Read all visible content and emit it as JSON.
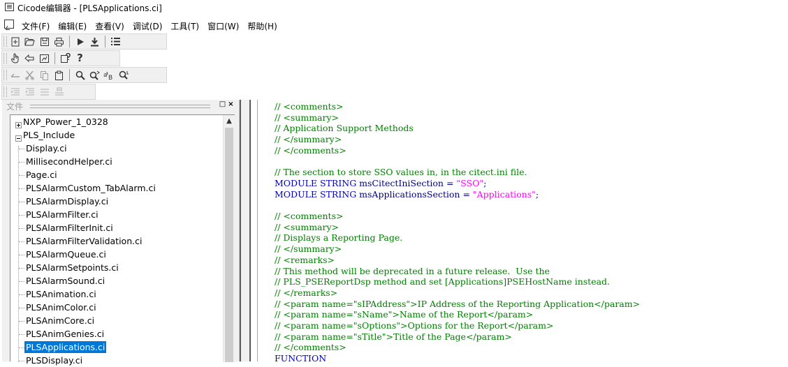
{
  "window": {
    "title": "Cicode编辑器 - [PLSApplications.ci]"
  },
  "menu": {
    "items": [
      "文件(F)",
      "编辑(E)",
      "查看(V)",
      "调试(D)",
      "工具(T)",
      "窗口(W)",
      "帮助(H)"
    ]
  },
  "toolbars": {
    "row1": [
      "new-file-icon",
      "open-folder-icon",
      "save-icon",
      "print-icon",
      "run-icon",
      "compile-icon",
      "list-icon"
    ],
    "row2": [
      "hand-icon",
      "undo-arrow-icon",
      "properties-icon",
      "help-context-icon",
      "help-icon"
    ],
    "row3": [
      "undo-icon",
      "cut-icon",
      "copy-icon",
      "paste-icon",
      "find-icon",
      "find-next-icon",
      "replace-icon",
      "find-in-files-icon"
    ],
    "row4": [
      "indent-icon",
      "outdent-icon",
      "align-icon",
      "bookmark-icon"
    ]
  },
  "files_panel": {
    "label": "文件",
    "minimize_btn": "□",
    "close_btn": "×",
    "tree": [
      {
        "label": "NXP_Power_1_0328",
        "level": 0,
        "expanded": false
      },
      {
        "label": "PLS_Include",
        "level": 0,
        "expanded": true
      },
      {
        "label": "Display.ci",
        "level": 1
      },
      {
        "label": "MillisecondHelper.ci",
        "level": 1
      },
      {
        "label": "Page.ci",
        "level": 1
      },
      {
        "label": "PLSAlarmCustom_TabAlarm.ci",
        "level": 1
      },
      {
        "label": "PLSAlarmDisplay.ci",
        "level": 1
      },
      {
        "label": "PLSAlarmFilter.ci",
        "level": 1
      },
      {
        "label": "PLSAlarmFilterInit.ci",
        "level": 1
      },
      {
        "label": "PLSAlarmFilterValidation.ci",
        "level": 1
      },
      {
        "label": "PLSAlarmQueue.ci",
        "level": 1
      },
      {
        "label": "PLSAlarmSetpoints.ci",
        "level": 1
      },
      {
        "label": "PLSAlarmSound.ci",
        "level": 1
      },
      {
        "label": "PLSAnimation.ci",
        "level": 1
      },
      {
        "label": "PLSAnimColor.ci",
        "level": 1
      },
      {
        "label": "PLSAnimCore.ci",
        "level": 1
      },
      {
        "label": "PLSAnimGenies.ci",
        "level": 1
      },
      {
        "label": "PLSApplications.ci",
        "level": 1,
        "selected": true
      },
      {
        "label": "PLSDisplay.ci",
        "level": 1
      }
    ]
  },
  "colors": {
    "comment": "#008000",
    "keyword": "#0000c0",
    "string": "#ff00ff",
    "selection": "#0078d7"
  },
  "editor": {
    "lines": [
      [
        {
          "t": "// <comments>",
          "c": "comment"
        }
      ],
      [
        {
          "t": "// <summary>",
          "c": "comment"
        }
      ],
      [
        {
          "t": "// Application Support Methods",
          "c": "comment"
        }
      ],
      [
        {
          "t": "// </summary>",
          "c": "comment"
        }
      ],
      [
        {
          "t": "// </comments>",
          "c": "comment"
        }
      ],
      [],
      [
        {
          "t": "// The section to store SSO values in, in the citect.ini file.",
          "c": "comment"
        }
      ],
      [
        {
          "t": "MODULE STRING ",
          "c": "kw"
        },
        {
          "t": "msCitectIniSection = ",
          "c": "plain"
        },
        {
          "t": "\"SSO\"",
          "c": "str"
        },
        {
          "t": ";",
          "c": "plain"
        }
      ],
      [
        {
          "t": "MODULE STRING ",
          "c": "kw"
        },
        {
          "t": "msApplicationsSection = ",
          "c": "plain"
        },
        {
          "t": "\"Applications\"",
          "c": "str"
        },
        {
          "t": ";",
          "c": "plain"
        }
      ],
      [],
      [
        {
          "t": "// <comments>",
          "c": "comment"
        }
      ],
      [
        {
          "t": "// <summary>",
          "c": "comment"
        }
      ],
      [
        {
          "t": "// Displays a Reporting Page.",
          "c": "comment"
        }
      ],
      [
        {
          "t": "// </summary>",
          "c": "comment"
        }
      ],
      [
        {
          "t": "// <remarks>",
          "c": "comment"
        }
      ],
      [
        {
          "t": "// This method will be deprecated in a future release.  Use the",
          "c": "comment"
        }
      ],
      [
        {
          "t": "// PLS_PSEReportDsp method and set [Applications]PSEHostName instead.",
          "c": "comment"
        }
      ],
      [
        {
          "t": "// </remarks>",
          "c": "comment"
        }
      ],
      [
        {
          "t": "// <param name=\"sIPAddress\">IP Address of the Reporting Application</param>",
          "c": "comment"
        }
      ],
      [
        {
          "t": "// <param name=\"sName\">Name of the Report</param>",
          "c": "comment"
        }
      ],
      [
        {
          "t": "// <param name=\"sOptions\">Options for the Report</param>",
          "c": "comment"
        }
      ],
      [
        {
          "t": "// <param name=\"sTitle\">Title of the Page</param>",
          "c": "comment"
        }
      ],
      [
        {
          "t": "// </comments>",
          "c": "comment"
        }
      ],
      [
        {
          "t": "FUNCTION",
          "c": "kw"
        }
      ]
    ]
  }
}
